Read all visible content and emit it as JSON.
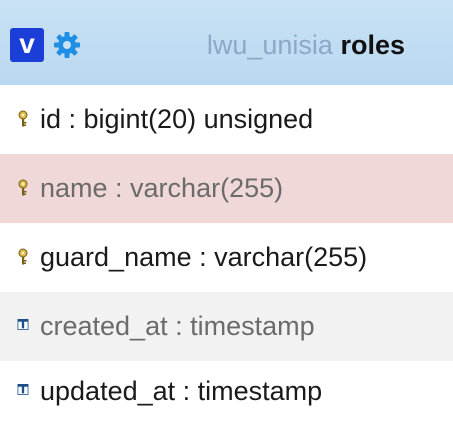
{
  "header": {
    "toggle_label": "v",
    "database": "lwu_unisia",
    "table": "roles"
  },
  "columns": [
    {
      "text": "id : bigint(20) unsigned",
      "icon": "key-icon",
      "state": "normal"
    },
    {
      "text": "name : varchar(255)",
      "icon": "key-icon",
      "state": "highlighted"
    },
    {
      "text": "guard_name : varchar(255)",
      "icon": "key-icon",
      "state": "normal"
    },
    {
      "text": "created_at : timestamp",
      "icon": "column-icon",
      "state": "grey"
    },
    {
      "text": "updated_at : timestamp",
      "icon": "column-icon",
      "state": "normal"
    }
  ],
  "colors": {
    "header_bg": "#c9e2f5",
    "toggle_bg": "#1b3fd6",
    "highlight_row": "#f1d8d8",
    "alt_row": "#f2f2f2",
    "db_name": "#8aa9c9"
  }
}
